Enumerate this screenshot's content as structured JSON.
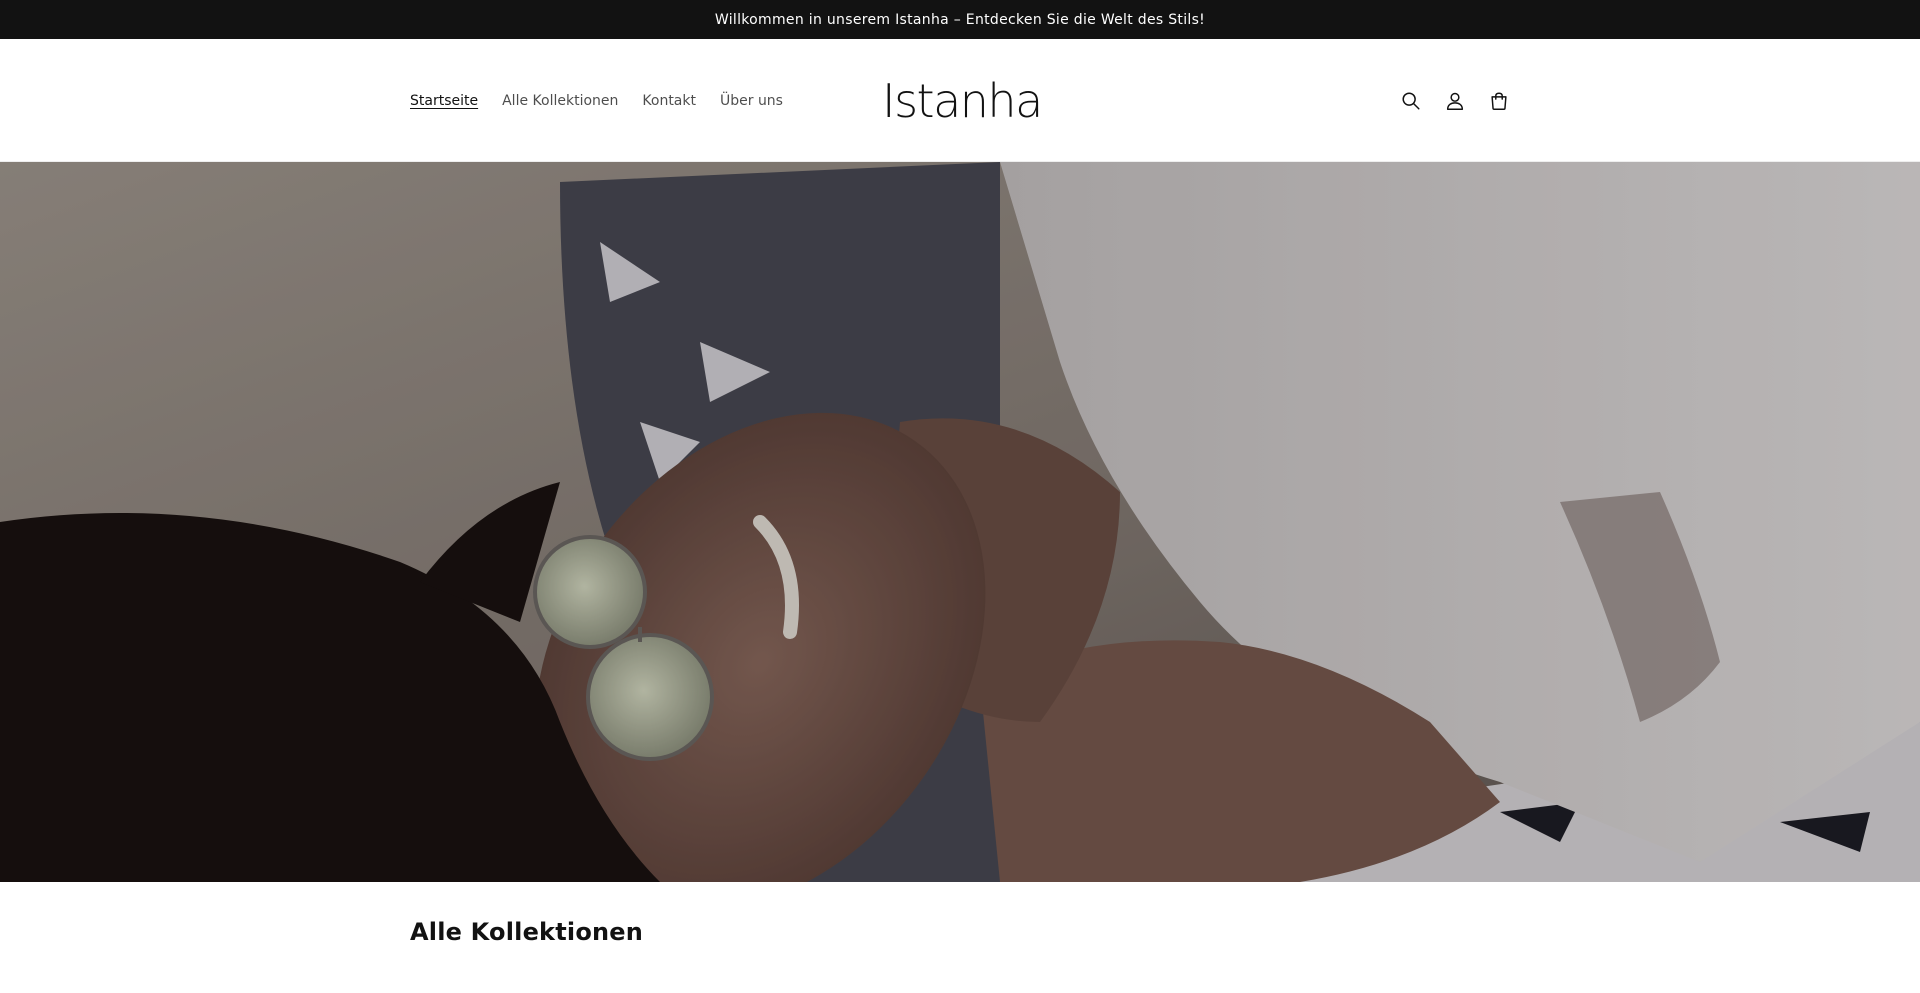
{
  "announcement": {
    "text": "Willkommen in unserem Istanha – Entdecken Sie die Welt des Stils!"
  },
  "header": {
    "logo_text": "Istanha",
    "nav": [
      {
        "label": "Startseite",
        "active": true
      },
      {
        "label": "Alle Kollektionen",
        "active": false
      },
      {
        "label": "Kontakt",
        "active": false
      },
      {
        "label": "Über uns",
        "active": false
      }
    ],
    "icons": [
      "search-icon",
      "account-icon",
      "cart-icon"
    ]
  },
  "hero": {
    "image": "woman-lying-on-beach-towel-with-sunglasses"
  },
  "sections": {
    "collections_title": "Alle Kollektionen"
  },
  "colors": {
    "announcement_bg": "#121212",
    "text": "#121212",
    "background": "#ffffff"
  }
}
